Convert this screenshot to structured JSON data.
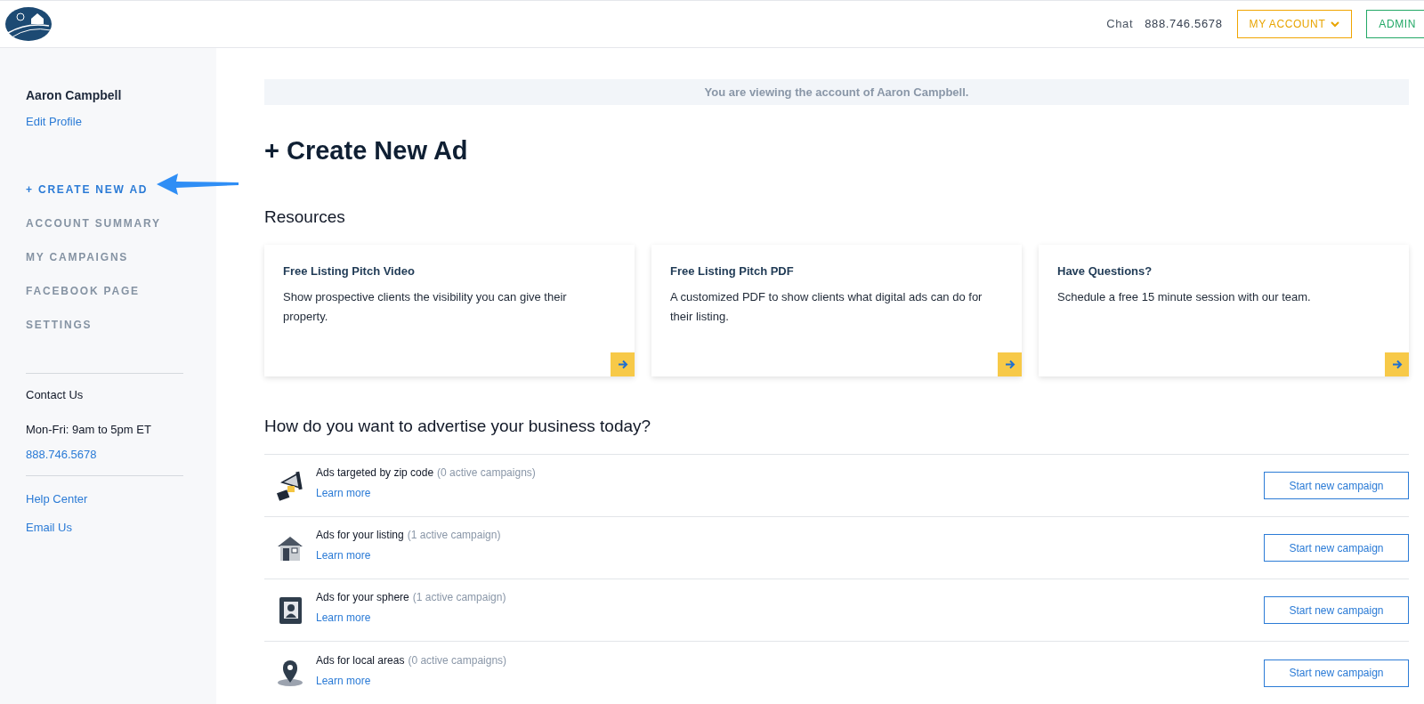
{
  "header": {
    "chat": "Chat",
    "phone": "888.746.5678",
    "account_button": "MY ACCOUNT",
    "admin_button": "ADMIN"
  },
  "sidebar": {
    "user_name": "Aaron Campbell",
    "edit_profile": "Edit Profile",
    "nav": [
      {
        "label": "+ CREATE NEW AD",
        "selected": true
      },
      {
        "label": "ACCOUNT SUMMARY",
        "selected": false
      },
      {
        "label": "MY CAMPAIGNS",
        "selected": false
      },
      {
        "label": "FACEBOOK PAGE",
        "selected": false
      },
      {
        "label": "SETTINGS",
        "selected": false
      }
    ],
    "contact_title": "Contact Us",
    "hours": "Mon-Fri: 9am to 5pm ET",
    "phone": "888.746.5678",
    "links": [
      "Help Center",
      "Email Us"
    ]
  },
  "banner": "You are viewing the account of Aaron Campbell.",
  "page_title": "+ Create New Ad",
  "resources_title": "Resources",
  "resources": [
    {
      "title": "Free Listing Pitch Video",
      "text": "Show prospective clients the visibility you can give their property."
    },
    {
      "title": "Free Listing Pitch PDF",
      "text": "A customized PDF to show clients what digital ads can do for their listing."
    },
    {
      "title": "Have Questions?",
      "text": "Schedule a free 15 minute session with our team."
    }
  ],
  "question": "How do you want to advertise your business today?",
  "options": [
    {
      "kind": "megaphone",
      "title": "Ads targeted by zip code",
      "count": "(0 active campaigns)",
      "link": "Learn more",
      "button": "Start new campaign"
    },
    {
      "kind": "house",
      "title": "Ads for your listing",
      "count": "(1 active campaign)",
      "link": "Learn more",
      "button": "Start new campaign"
    },
    {
      "kind": "contacts",
      "title": "Ads for your sphere",
      "count": "(1 active campaign)",
      "link": "Learn more",
      "button": "Start new campaign"
    },
    {
      "kind": "pin",
      "title": "Ads for local areas",
      "count": "(0 active campaigns)",
      "link": "Learn more",
      "button": "Start new campaign"
    }
  ]
}
